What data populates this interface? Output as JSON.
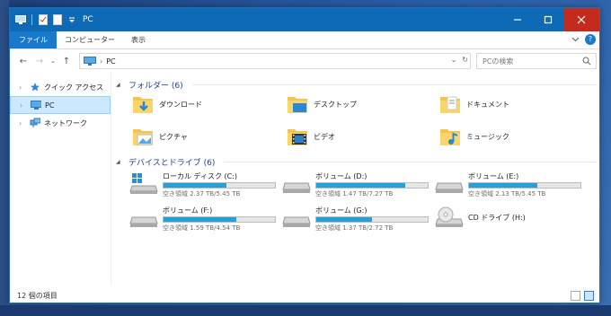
{
  "window": {
    "title": "PC"
  },
  "ribbon": {
    "tabs": [
      "ファイル",
      "コンピューター",
      "表示"
    ]
  },
  "address": {
    "path": "PC"
  },
  "search": {
    "placeholder": "PCの検索"
  },
  "sidebar": {
    "items": [
      {
        "label": "クイック アクセス",
        "icon": "quick-access-star-icon"
      },
      {
        "label": "PC",
        "icon": "pc-icon"
      },
      {
        "label": "ネットワーク",
        "icon": "network-icon"
      }
    ]
  },
  "folders": {
    "header": "フォルダー (6)",
    "items": [
      {
        "label": "ダウンロード",
        "icon": "downloads-folder-icon"
      },
      {
        "label": "デスクトップ",
        "icon": "desktop-folder-icon"
      },
      {
        "label": "ドキュメント",
        "icon": "documents-folder-icon"
      },
      {
        "label": "ピクチャ",
        "icon": "pictures-folder-icon"
      },
      {
        "label": "ビデオ",
        "icon": "videos-folder-icon"
      },
      {
        "label": "ミュージック",
        "icon": "music-folder-icon"
      }
    ]
  },
  "drives": {
    "header": "デバイスとドライブ (6)",
    "items": [
      {
        "name": "ローカル ディスク (C:)",
        "free": "空き領域 2.37 TB/5.45 TB",
        "used_fraction": 0.565,
        "icon": "windows-drive-icon"
      },
      {
        "name": "ボリューム (D:)",
        "free": "空き領域 1.47 TB/7.27 TB",
        "used_fraction": 0.798,
        "icon": "hard-drive-icon"
      },
      {
        "name": "ボリューム (E:)",
        "free": "空き領域 2.13 TB/5.45 TB",
        "used_fraction": 0.609,
        "icon": "hard-drive-icon"
      },
      {
        "name": "ボリューム (F:)",
        "free": "空き領域 1.59 TB/4.54 TB",
        "used_fraction": 0.65,
        "icon": "hard-drive-icon"
      },
      {
        "name": "ボリューム (G:)",
        "free": "空き領域 1.37 TB/2.72 TB",
        "used_fraction": 0.496,
        "icon": "hard-drive-icon"
      },
      {
        "name": "CD ドライブ (H:)",
        "free": "",
        "used_fraction": null,
        "icon": "cd-drive-icon"
      }
    ]
  },
  "status": {
    "count": "12 個の項目"
  },
  "colors": {
    "accent": "#0e6ab5",
    "bar_fill": "#26a0da",
    "close": "#c42b1c",
    "group_header": "#1e3f8a"
  }
}
